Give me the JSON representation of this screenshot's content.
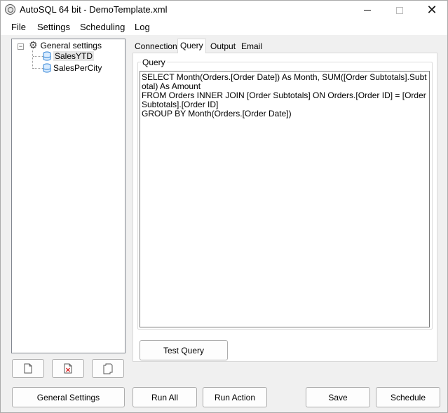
{
  "window": {
    "title": "AutoSQL 64 bit - DemoTemplate.xml"
  },
  "menu": {
    "file": "File",
    "settings": "Settings",
    "scheduling": "Scheduling",
    "log": "Log"
  },
  "tree": {
    "root": "General settings",
    "items": [
      {
        "label": "SalesYTD",
        "selected": true
      },
      {
        "label": "SalesPerCity",
        "selected": false
      }
    ]
  },
  "tabs": [
    {
      "label": "Connection",
      "active": false
    },
    {
      "label": "Query",
      "active": true
    },
    {
      "label": "Output",
      "active": false
    },
    {
      "label": "Email",
      "active": false
    }
  ],
  "query": {
    "group_title": "Query",
    "text": "SELECT Month(Orders.[Order Date]) As Month, SUM([Order Subtotals].Subtotal) As Amount\nFROM Orders INNER JOIN [Order Subtotals] ON Orders.[Order ID] = [Order Subtotals].[Order ID]\nGROUP BY Month(Orders.[Order Date])",
    "test_button": "Test Query"
  },
  "buttons": {
    "general_settings": "General Settings",
    "run_all": "Run All",
    "run_action": "Run Action",
    "save": "Save",
    "schedule": "Schedule"
  },
  "icons": {
    "app": "app-icon",
    "gear": "gear-icon",
    "database": "database-icon",
    "new": "new-document-icon",
    "delete": "delete-document-icon",
    "copy": "copy-document-icon"
  }
}
